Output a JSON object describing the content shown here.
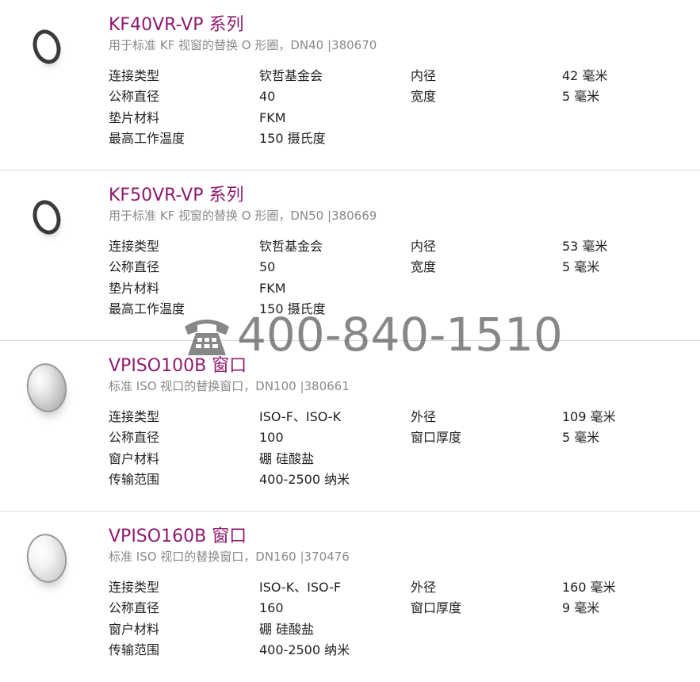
{
  "products": [
    {
      "image": "o-ring-icon",
      "title": "KF40VR-VP 系列",
      "subtitle": "用于标准 KF 视窗的替换 O 形圈，DN40 |380670",
      "specs": [
        [
          "连接类型",
          "钦哲基金会",
          "内径",
          "42 毫米"
        ],
        [
          "公称直径",
          "40",
          "宽度",
          "5 毫米"
        ],
        [
          "垫片材料",
          "FKM",
          "",
          ""
        ],
        [
          "最高工作温度",
          "150 摄氏度",
          "",
          ""
        ]
      ]
    },
    {
      "image": "o-ring-icon",
      "title": "KF50VR-VP 系列",
      "subtitle": "用于标准 KF 视窗的替换 O 形圈，DN50 |380669",
      "specs": [
        [
          "连接类型",
          "钦哲基金会",
          "内径",
          "53 毫米"
        ],
        [
          "公称直径",
          "50",
          "宽度",
          "5 毫米"
        ],
        [
          "垫片材料",
          "FKM",
          "",
          ""
        ],
        [
          "最高工作温度",
          "150 摄氏度",
          "",
          ""
        ]
      ]
    },
    {
      "image": "window-disc-icon",
      "title": "VPISO100B 窗口",
      "subtitle": "标准 ISO 视口的替换窗口，DN100 |380661",
      "specs": [
        [
          "连接类型",
          "ISO-F、ISO-K",
          "外径",
          "109 毫米"
        ],
        [
          "公称直径",
          "100",
          "窗口厚度",
          "5 毫米"
        ],
        [
          "窗户材料",
          "硼 硅酸盐",
          "",
          ""
        ],
        [
          "传输范围",
          "400-2500 纳米",
          "",
          ""
        ]
      ]
    },
    {
      "image": "window-disc-icon",
      "title": "VPISO160B 窗口",
      "subtitle": "标准 ISO 视口的替换窗口，DN160 |370476",
      "specs": [
        [
          "连接类型",
          "ISO-K、ISO-F",
          "外径",
          "160 毫米"
        ],
        [
          "公称直径",
          "160",
          "窗口厚度",
          "9 毫米"
        ],
        [
          "窗户材料",
          "硼 硅酸盐",
          "",
          ""
        ],
        [
          "传输范围",
          "400-2500 纳米",
          "",
          ""
        ]
      ]
    }
  ],
  "watermark": {
    "icon": "telephone-icon",
    "number": "400-840-1510"
  },
  "colors": {
    "title": "#8e1a6e",
    "subtitle": "#8a8a8a",
    "divider": "#d6d6d6"
  }
}
